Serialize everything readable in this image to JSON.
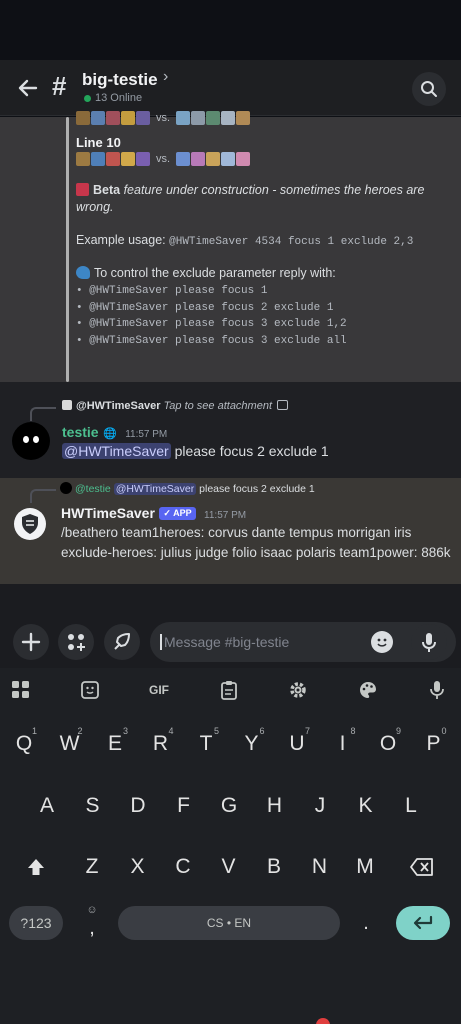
{
  "header": {
    "channel_name": "big-testie",
    "chevron": "›",
    "online": "13 Online",
    "back_icon": "arrow-left-icon",
    "search_icon": "search-icon"
  },
  "embed": {
    "vs_text": "vs.",
    "line_title": "Line 10",
    "beta_bold": "Beta",
    "beta_italic": "feature under construction - sometimes the heroes are wrong.",
    "example_label": "Example usage:",
    "example_code": "@HWTimeSaver 4534 focus 1 exclude 2,3",
    "control_text": "To control the exclude parameter reply with:",
    "commands": [
      "@HWTimeSaver please focus 1",
      "@HWTimeSaver please focus 2 exclude 1",
      "@HWTimeSaver please focus 3 exclude 1,2",
      "@HWTimeSaver please focus 3 exclude all"
    ]
  },
  "message1": {
    "reply_author": "@HWTimeSaver",
    "reply_text": "Tap to see attachment",
    "author": "testie",
    "author_badge": "🌐",
    "time": "11:57 PM",
    "mention": "@HWTimeSaver",
    "text": " please focus 2 exclude 1"
  },
  "message2": {
    "reply_author": "@testie",
    "reply_mention": "@HWTimeSaver",
    "reply_text": "please focus 2 exclude 1",
    "author": "HWTimeSaver",
    "badge": "✓ APP",
    "time": "11:57 PM",
    "text": "/beathero team1heroes: corvus dante tempus morrigan iris exclude-heroes: julius judge folio isaac polaris team1power: 886k"
  },
  "composer": {
    "placeholder": "Message #big-testie"
  },
  "keyboard": {
    "toolbar": [
      "apps-grid-icon",
      "sticker-icon",
      "GIF",
      "clipboard-icon",
      "gear-icon",
      "palette-icon",
      "mic-icon"
    ],
    "gif_label": "GIF",
    "row1": [
      "Q",
      "W",
      "E",
      "R",
      "T",
      "Y",
      "U",
      "I",
      "O",
      "P"
    ],
    "row1_digits": [
      "1",
      "2",
      "3",
      "4",
      "5",
      "6",
      "7",
      "8",
      "9",
      "0"
    ],
    "row2": [
      "A",
      "S",
      "D",
      "F",
      "G",
      "H",
      "J",
      "K",
      "L"
    ],
    "row3": [
      "Z",
      "X",
      "C",
      "V",
      "B",
      "N",
      "M"
    ],
    "sym_key": "?123",
    "comma": ",",
    "space_label": "CS • EN",
    "period": "."
  },
  "colors": {
    "accent": "#5865f2",
    "online": "#23a55a",
    "author1": "#4cbf8f",
    "enter": "#7fd2c8"
  }
}
